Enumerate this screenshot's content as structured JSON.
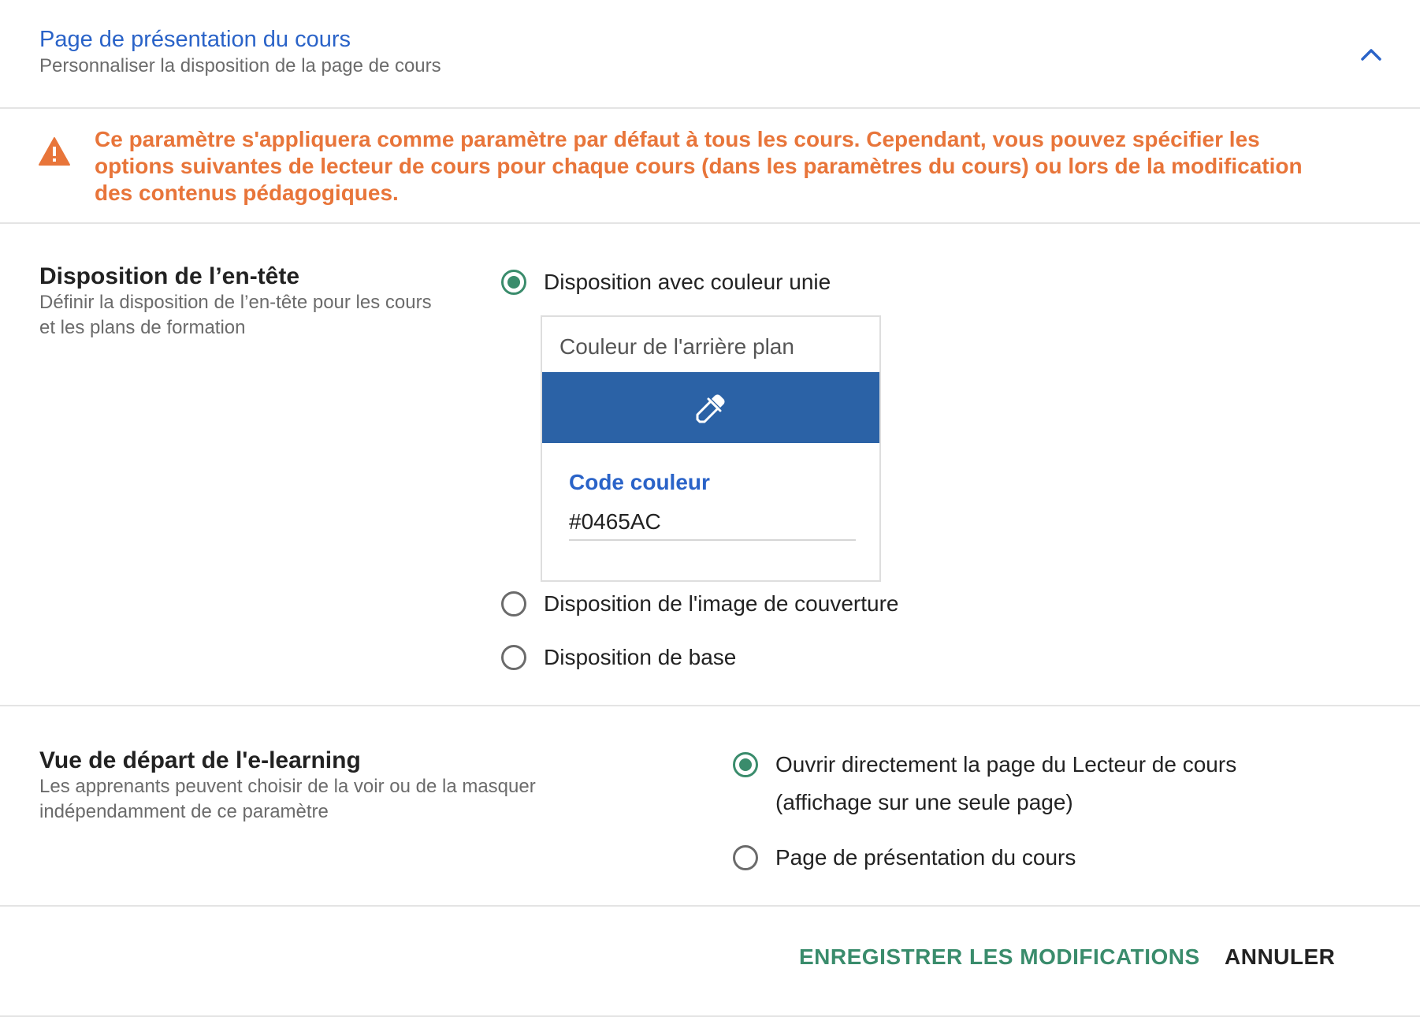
{
  "header": {
    "title": "Page de présentation du cours",
    "subtitle": "Personnaliser la disposition de la page de cours",
    "collapse_icon": "chevron-up-icon"
  },
  "warning": {
    "icon": "warning-triangle-icon",
    "text": "Ce paramètre s'appliquera comme paramètre par défaut à tous les cours. Cependant, vous pouvez spécifier les options suivantes de lecteur de cours pour chaque cours (dans les paramètres du cours) ou lors de la modification des contenus pédagogiques.",
    "color": "#e8753a"
  },
  "header_layout": {
    "title": "Disposition de l’en-tête",
    "description": "Définir la disposition de l’en-tête pour les cours et les plans de formation",
    "options": [
      {
        "label": "Disposition avec couleur unie",
        "selected": true
      },
      {
        "label": "Disposition de l'image de couverture",
        "selected": false
      },
      {
        "label": "Disposition de base",
        "selected": false
      }
    ],
    "color_picker": {
      "title": "Couleur de l'arrière plan",
      "swatch_color": "#2b62a6",
      "icon": "eyedropper-icon",
      "code_label": "Code couleur",
      "code_value": "#0465AC"
    }
  },
  "elearning_view": {
    "title": "Vue de départ de l'e-learning",
    "description": "Les apprenants peuvent choisir de la voir ou de la masquer indépendamment de ce paramètre",
    "options": [
      {
        "label": "Ouvrir directement la page du Lecteur de cours (affichage sur une seule page)",
        "selected": true
      },
      {
        "label": "Page de présentation du cours",
        "selected": false
      }
    ]
  },
  "footer": {
    "save_label": "ENREGISTRER LES MODIFICATIONS",
    "cancel_label": "ANNULER"
  },
  "colors": {
    "accent_blue": "#2a63c8",
    "accent_green": "#3a8c6c"
  }
}
